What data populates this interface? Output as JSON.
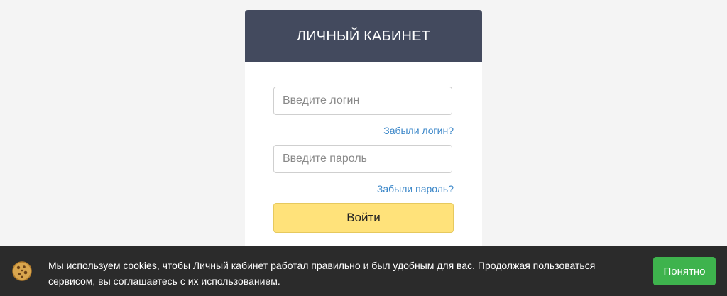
{
  "login_card": {
    "title": "ЛИЧНЫЙ КАБИНЕТ",
    "login_placeholder": "Введите логин",
    "forgot_login": "Забыли логин?",
    "password_placeholder": "Введите пароль",
    "forgot_password": "Забыли пароль?",
    "submit_label": "Войти"
  },
  "cookie_banner": {
    "icon": "cookie-icon",
    "text": "Мы используем cookies, чтобы Личный кабинет работал правильно и был удобным для вас. Продолжая пользоваться сервисом, вы соглашаетесь с их использованием.",
    "accept_label": "Понятно"
  },
  "colors": {
    "header_bg": "#434a5e",
    "submit_bg": "#ffe27a",
    "link": "#3a86c8",
    "cookie_bar_bg": "#2b2b2b",
    "accept_bg": "#3eb34d"
  }
}
